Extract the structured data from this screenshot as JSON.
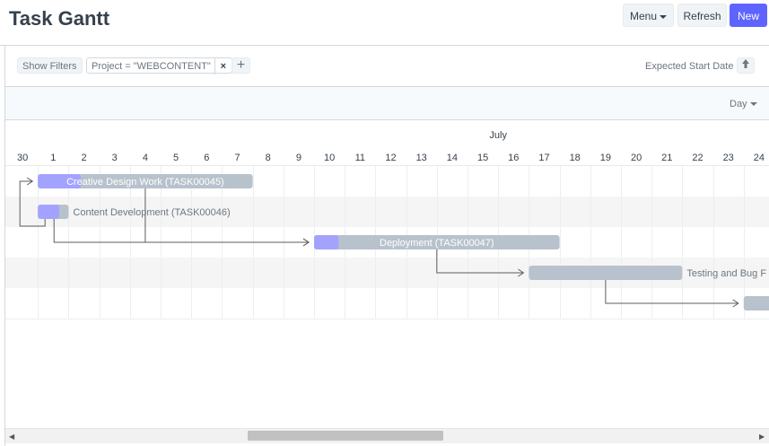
{
  "page": {
    "title": "Task Gantt"
  },
  "header": {
    "menu_label": "Menu",
    "refresh_label": "Refresh",
    "new_label": "New"
  },
  "filters": {
    "show_filters_label": "Show Filters",
    "active_filter": "Project = \"WEBCONTENT\"",
    "remove_icon": "×",
    "add_icon": "+"
  },
  "sort": {
    "label": "Expected Start Date",
    "direction_icon": "arrow-up-icon"
  },
  "view": {
    "mode": "Day"
  },
  "timeline": {
    "month_label": "July",
    "day_labels": [
      "30",
      "1",
      "2",
      "3",
      "4",
      "5",
      "6",
      "7",
      "8",
      "9",
      "10",
      "11",
      "12",
      "13",
      "14",
      "15",
      "16",
      "17",
      "18",
      "19",
      "20",
      "21",
      "22",
      "23",
      "24"
    ]
  },
  "tasks": [
    {
      "name": "Creative Design Work (TASK00045)",
      "start_day": 0.5,
      "end_day": 7.5,
      "progress": 0.2,
      "label_inside": true
    },
    {
      "name": "Content Development (TASK00046)",
      "start_day": 0.5,
      "end_day": 1.5,
      "progress": 0.7,
      "label_inside": false
    },
    {
      "name": "Deployment (TASK00047)",
      "start_day": 9.5,
      "end_day": 17.5,
      "progress": 0.1,
      "label_inside": true
    },
    {
      "name": "Testing and Bug F",
      "start_day": 16.5,
      "end_day": 21.5,
      "progress": 0,
      "label_inside": false
    },
    {
      "name": "",
      "start_day": 23.5,
      "end_day": 25.5,
      "progress": 0,
      "label_inside": false
    }
  ],
  "dependencies": [
    {
      "from": 1,
      "to": 0
    },
    {
      "from": 0,
      "to": 2
    },
    {
      "from": 1,
      "to": 2
    },
    {
      "from": 2,
      "to": 3
    },
    {
      "from": 3,
      "to": 4
    }
  ],
  "colors": {
    "bar": "#b8c2cc",
    "progress": "#a3a3ff",
    "primary": "#5e64ff",
    "row_alt": "#f5f5f5",
    "grid": "#ebeff2",
    "arrow": "#5c5c5c"
  }
}
